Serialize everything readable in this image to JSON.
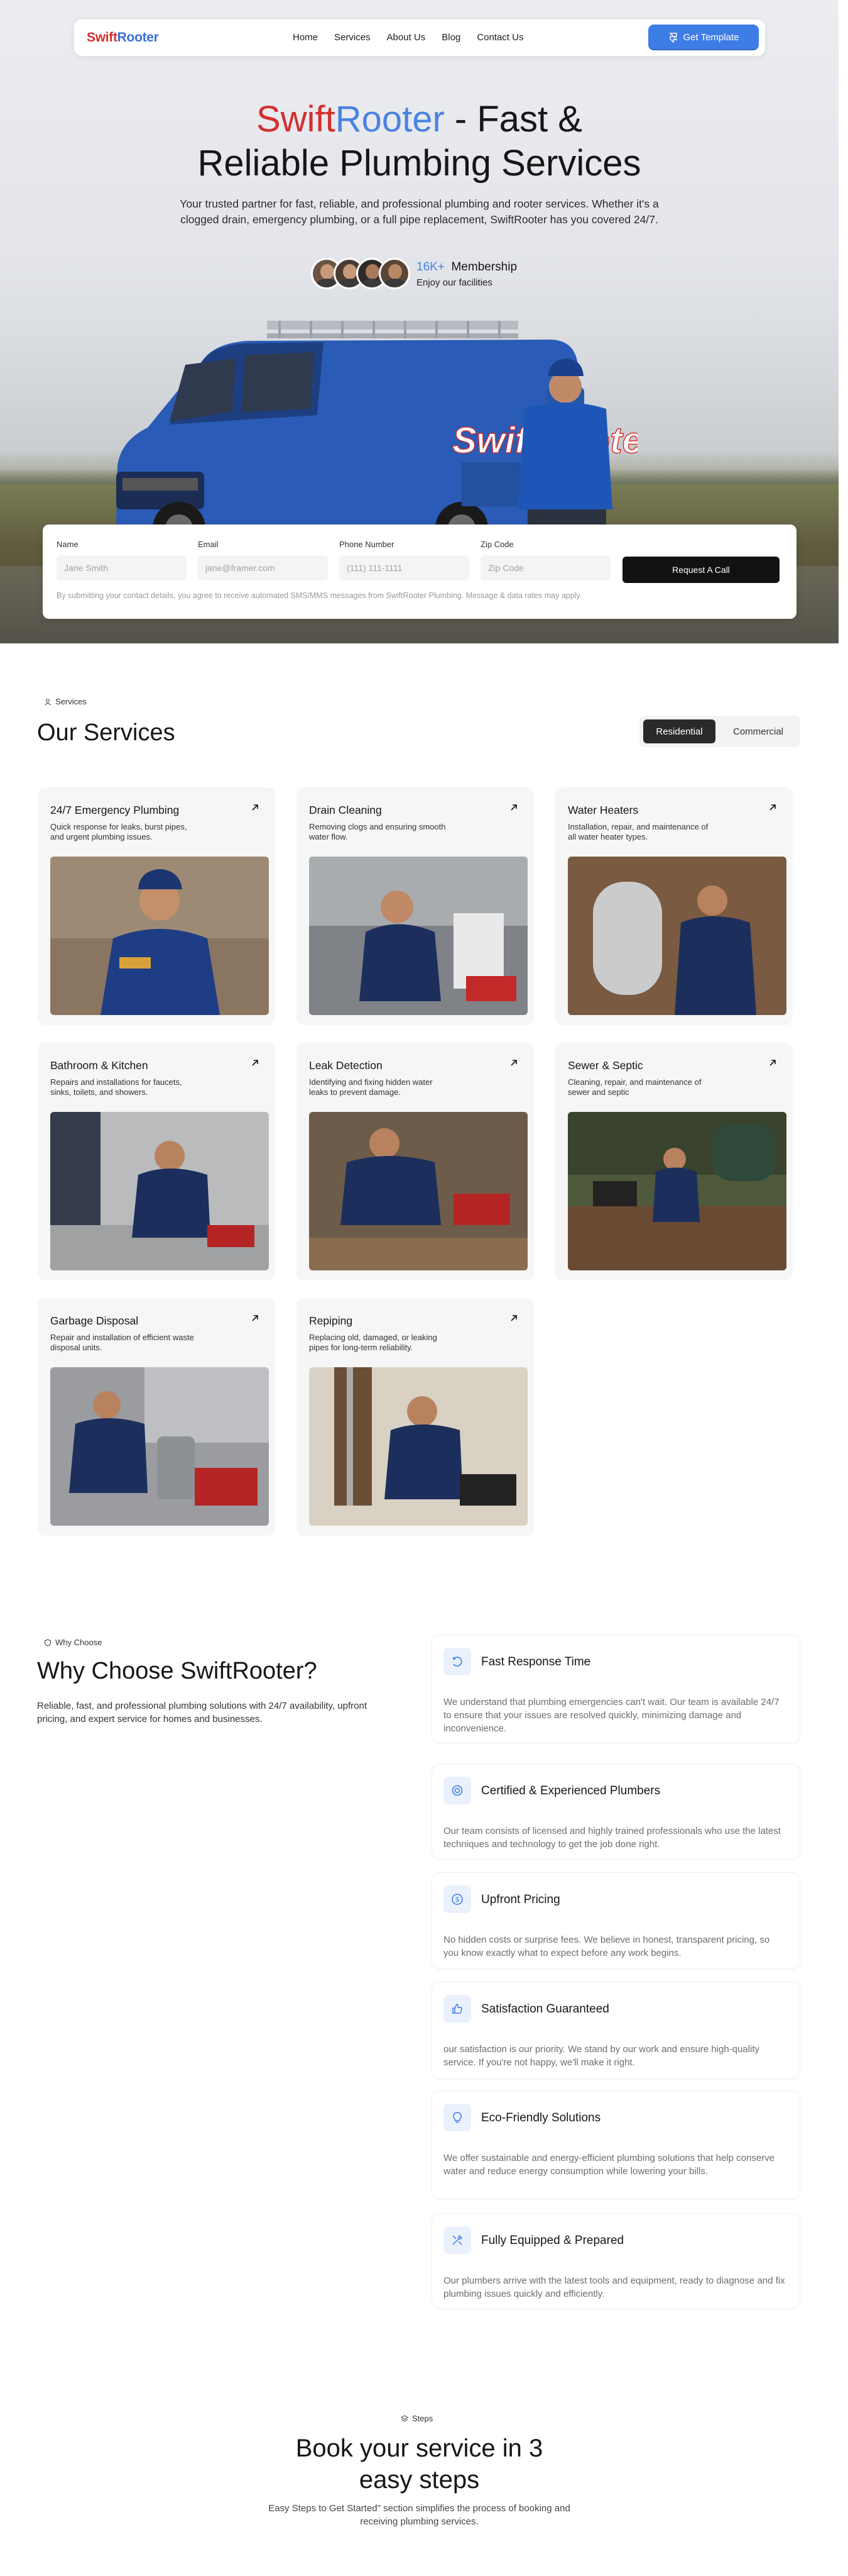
{
  "brand": {
    "part1": "Swift",
    "part2": "Rooter"
  },
  "nav": {
    "items": [
      "Home",
      "Services",
      "About Us",
      "Blog",
      "Contact Us"
    ],
    "cta": "Get Template"
  },
  "hero": {
    "title_brand1": "Swift",
    "title_brand2": "Rooter",
    "title_rest1": " - Fast &",
    "title_line2": "Reliable Plumbing Services",
    "subtitle": "Your trusted partner for fast, reliable, and professional plumbing and rooter services. Whether it's a clogged drain, emergency plumbing, or a full pipe replacement, SwiftRooter has you covered 24/7.",
    "membership_count": "16K+",
    "membership_label": "Membership",
    "membership_note": "Enjoy our facilities",
    "van_text": "SwiftRooter"
  },
  "form": {
    "name_label": "Name",
    "name_placeholder": "Jane Smith",
    "email_label": "Email",
    "email_placeholder": "jane@framer.com",
    "phone_label": "Phone Number",
    "phone_placeholder": "(111) 111-1111",
    "zip_label": "Zip Code",
    "zip_placeholder": "Zip Code",
    "submit": "Request A Call",
    "disclaimer": "By submitting your contact details, you agree to receive automated SMS/MMS messages from SwiftRooter Plumbing. Message & data rates may apply."
  },
  "services": {
    "tag": "Services",
    "title": "Our Services",
    "toggle_on": "Residential",
    "toggle_off": "Commercial",
    "cards": [
      {
        "title": "24/7 Emergency Plumbing",
        "desc": "Quick response for leaks, burst pipes, and urgent plumbing issues."
      },
      {
        "title": "Drain Cleaning",
        "desc": "Removing clogs and ensuring smooth water flow."
      },
      {
        "title": "Water Heaters",
        "desc": "Installation, repair, and maintenance of all water heater types."
      },
      {
        "title": "Bathroom & Kitchen",
        "desc": "Repairs and installations for faucets, sinks, toilets, and showers."
      },
      {
        "title": "Leak Detection",
        "desc": "Identifying and fixing hidden water leaks to prevent damage."
      },
      {
        "title": "Sewer & Septic",
        "desc": "Cleaning, repair, and maintenance of sewer and septic"
      },
      {
        "title": "Garbage Disposal",
        "desc": "Repair and installation of efficient waste disposal units."
      },
      {
        "title": "Repiping",
        "desc": "Replacing old, damaged, or leaking pipes for long-term reliability."
      }
    ]
  },
  "why": {
    "tag": "Why Choose",
    "title": "Why Choose SwiftRooter?",
    "subtitle": "Reliable, fast, and professional plumbing solutions with 24/7 availability, upfront pricing, and expert service for homes and businesses.",
    "items": [
      {
        "title": "Fast Response Time",
        "desc": "We understand that plumbing emergencies can't wait. Our team is available 24/7 to ensure that your issues are resolved quickly, minimizing damage and inconvenience."
      },
      {
        "title": "Certified & Experienced Plumbers",
        "desc": "Our team consists of licensed and highly trained professionals who use the latest techniques and technology to get the job done right."
      },
      {
        "title": "Upfront Pricing",
        "desc": "No hidden costs or surprise fees. We believe in honest, transparent pricing, so you know exactly what to expect before any work begins."
      },
      {
        "title": "Satisfaction Guaranteed",
        "desc": "our satisfaction is our priority. We stand by our work and ensure high-quality service. If you're not happy, we'll make it right."
      },
      {
        "title": "Eco-Friendly Solutions",
        "desc": "We offer sustainable and energy-efficient plumbing solutions that help conserve water and reduce energy consumption while lowering your bills."
      },
      {
        "title": "Fully Equipped & Prepared",
        "desc": "Our plumbers arrive with the latest tools and equipment, ready to diagnose and fix plumbing issues quickly and efficiently."
      }
    ]
  },
  "steps": {
    "tag": "Steps",
    "title_line1": "Book your service in 3",
    "title_line2": "easy steps",
    "subtitle": "Easy Steps to Get Started\" section simplifies the process of booking and receiving plumbing services."
  },
  "colors": {
    "brand_red": "#d42f2f",
    "brand_blue": "#3c6fd8",
    "accent_blue": "#3f7de6",
    "dark": "#111111"
  }
}
